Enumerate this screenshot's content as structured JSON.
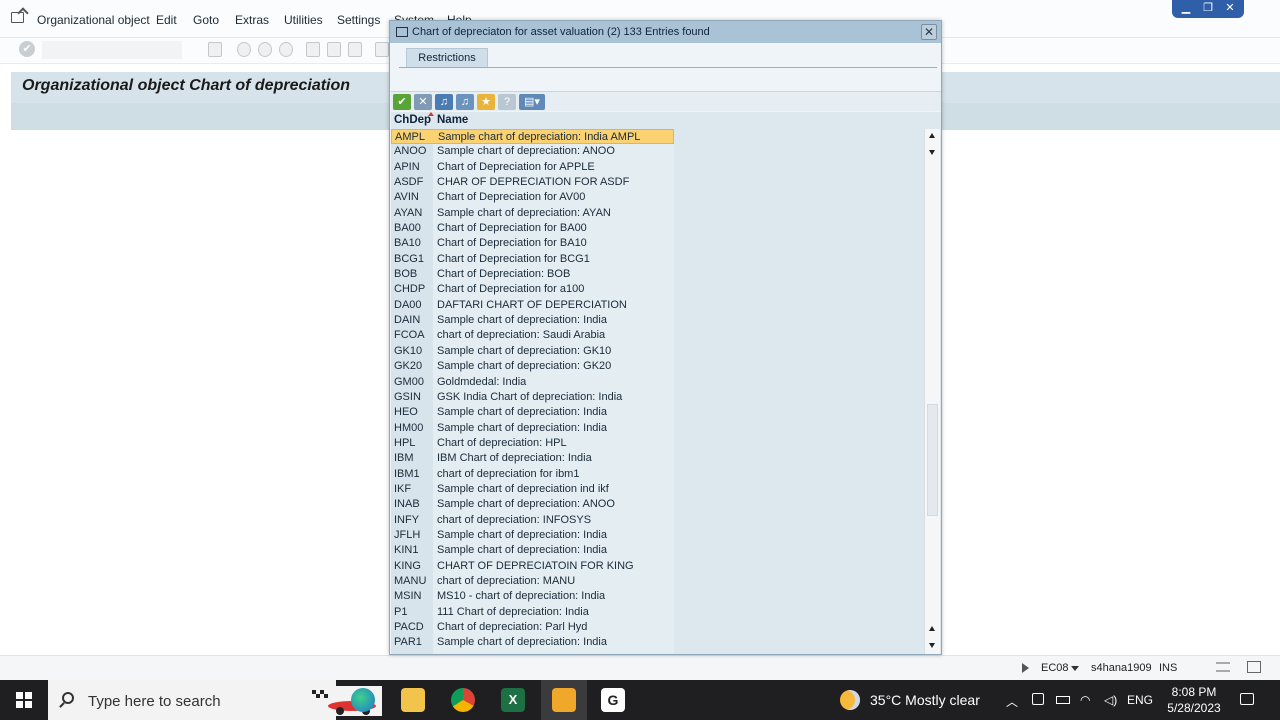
{
  "menu": {
    "items": [
      "Organizational object",
      "Edit",
      "Goto",
      "Extras",
      "Utilities",
      "Settings",
      "System",
      "Help"
    ]
  },
  "page": {
    "title": "Organizational object Chart of depreciation"
  },
  "dialog": {
    "title": "Chart of depreciaton for asset valuation (2)  133 Entries found",
    "tab": "Restrictions",
    "columns": [
      "ChDep",
      "Name"
    ],
    "rows": [
      [
        "AMPL",
        "Sample chart of depreciation: India AMPL"
      ],
      [
        "ANOO",
        "Sample chart of depreciation: ANOO"
      ],
      [
        "APIN",
        "Chart of Depreciation for APPLE"
      ],
      [
        "ASDF",
        "CHAR OF DEPRECIATION FOR ASDF"
      ],
      [
        "AVIN",
        "Chart of Depreciation for AV00"
      ],
      [
        "AYAN",
        "Sample chart of depreciation: AYAN"
      ],
      [
        "BA00",
        "Chart of Depreciation for BA00"
      ],
      [
        "BA10",
        "Chart of Depreciation for BA10"
      ],
      [
        "BCG1",
        "Chart of Depreciation for BCG1"
      ],
      [
        "BOB",
        "Chart of Depreciation: BOB"
      ],
      [
        "CHDP",
        "Chart of Depreciation for a100"
      ],
      [
        "DA00",
        "DAFTARI CHART OF DEPERCIATION"
      ],
      [
        "DAIN",
        "Sample chart of depreciation: India"
      ],
      [
        "FCOA",
        "chart of depreciation: Saudi Arabia"
      ],
      [
        "GK10",
        "Sample chart of depreciation: GK10"
      ],
      [
        "GK20",
        "Sample chart of depreciation: GK20"
      ],
      [
        "GM00",
        "Goldmdedal: India"
      ],
      [
        "GSIN",
        "GSK India Chart of depreciation: India"
      ],
      [
        "HEO",
        "Sample chart of depreciation: India"
      ],
      [
        "HM00",
        "Sample chart of depreciation: India"
      ],
      [
        "HPL",
        "Chart of depreciation: HPL"
      ],
      [
        "IBM",
        "IBM  Chart of depreciation: India"
      ],
      [
        "IBM1",
        "chart of depreciation for ibm1"
      ],
      [
        "IKF",
        "Sample chart of depreciation ind ikf"
      ],
      [
        "INAB",
        "Sample chart of depreciation: ANOO"
      ],
      [
        "INFY",
        "chart of depreciation: INFOSYS"
      ],
      [
        "JFLH",
        "Sample chart of depreciation: India"
      ],
      [
        "KIN1",
        "Sample chart of depreciation: India"
      ],
      [
        "KING",
        "CHART OF DEPRECIATOIN FOR KING"
      ],
      [
        "MANU",
        "chart of depreciation: MANU"
      ],
      [
        "MSIN",
        "MS10 - chart of depreciation: India"
      ],
      [
        "P1",
        "111  Chart of depreciation: India"
      ],
      [
        "PACD",
        "Chart of depreciation: Parl Hyd"
      ],
      [
        "PAR1",
        "Sample chart of depreciation: India"
      ]
    ]
  },
  "status": {
    "system": "EC08",
    "server": "s4hana1909",
    "mode": "INS"
  },
  "taskbar": {
    "search_placeholder": "Type here to search",
    "weather": "35°C  Mostly clear",
    "language": "ENG",
    "time": "8:08 PM",
    "date": "5/28/2023"
  }
}
